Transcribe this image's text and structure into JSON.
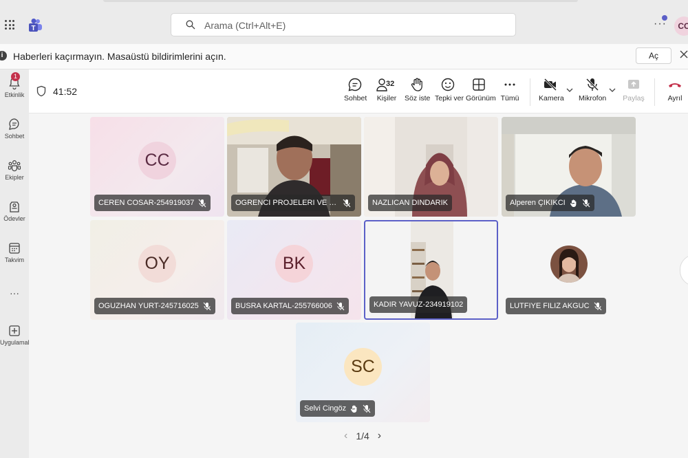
{
  "search": {
    "placeholder": "Arama (Ctrl+Alt+E)"
  },
  "user": {
    "initials": "CC"
  },
  "notification": {
    "text": "Haberleri kaçırmayın. Masaüstü bildirimlerini açın.",
    "button": "Aç"
  },
  "rail": [
    {
      "label": "Etkinlik",
      "icon": "bell-icon",
      "badge": "1"
    },
    {
      "label": "Sohbet",
      "icon": "chat-icon"
    },
    {
      "label": "Ekipler",
      "icon": "teams-icon"
    },
    {
      "label": "Ödevler",
      "icon": "assignments-icon"
    },
    {
      "label": "Takvim",
      "icon": "calendar-icon"
    },
    {
      "label": "",
      "icon": "more-icon"
    },
    {
      "label": "Uygulamalar",
      "icon": "apps-icon"
    }
  ],
  "meeting": {
    "timer": "41:52",
    "controls": {
      "chat": "Sohbet",
      "people": "Kişiler",
      "people_count": "32",
      "raise": "Söz iste",
      "react": "Tepki ver",
      "view": "Görünüm",
      "more": "Tümü",
      "camera": "Kamera",
      "mic": "Mikrofon",
      "share": "Paylaş",
      "leave": "Ayrıl"
    }
  },
  "participants": [
    {
      "name": "CEREN COSAR-254919037",
      "initials": "CC",
      "type": "avatar",
      "avatar_bg": "#f0d3de",
      "avatar_fg": "#5b2b43",
      "bg": "linear-gradient(135deg,#f7dfe8,#f3e9ee 60%,#efe3ef)"
    },
    {
      "name": "OGRENCI PROJELERI VE YARISMALAR",
      "type": "video"
    },
    {
      "name": "NAZLICAN DINDARIK",
      "type": "video"
    },
    {
      "name": "Alperen ÇIKIKCI",
      "type": "video",
      "hand": true
    },
    {
      "name": "OGUZHAN YURT-245716025",
      "initials": "OY",
      "type": "avatar",
      "avatar_bg": "#f2dcd8",
      "avatar_fg": "#4a2b26",
      "bg": "linear-gradient(135deg,#f1efe6,#f5eeeb 60%,#f0e9ee)"
    },
    {
      "name": "BUSRA KARTAL-255766006",
      "initials": "BK",
      "type": "avatar",
      "avatar_bg": "#f5d4d9",
      "avatar_fg": "#5a1f2b",
      "bg": "linear-gradient(135deg,#e9eaf5,#f2e6ef 60%,#f5e4ec)"
    },
    {
      "name": "KADIR YAVUZ-234919102",
      "type": "video",
      "active": true
    },
    {
      "name": "LUTFIYE FILIZ AKGUC",
      "type": "photo"
    },
    {
      "name": "Selvi Cingöz",
      "initials": "SC",
      "type": "avatar",
      "avatar_bg": "#fbe6c0",
      "avatar_fg": "#5a3a10",
      "bg": "linear-gradient(135deg,#e5eef5,#eef1f6 60%,#f3ecef)",
      "hand": true
    }
  ],
  "pager": {
    "text": "1/4"
  }
}
